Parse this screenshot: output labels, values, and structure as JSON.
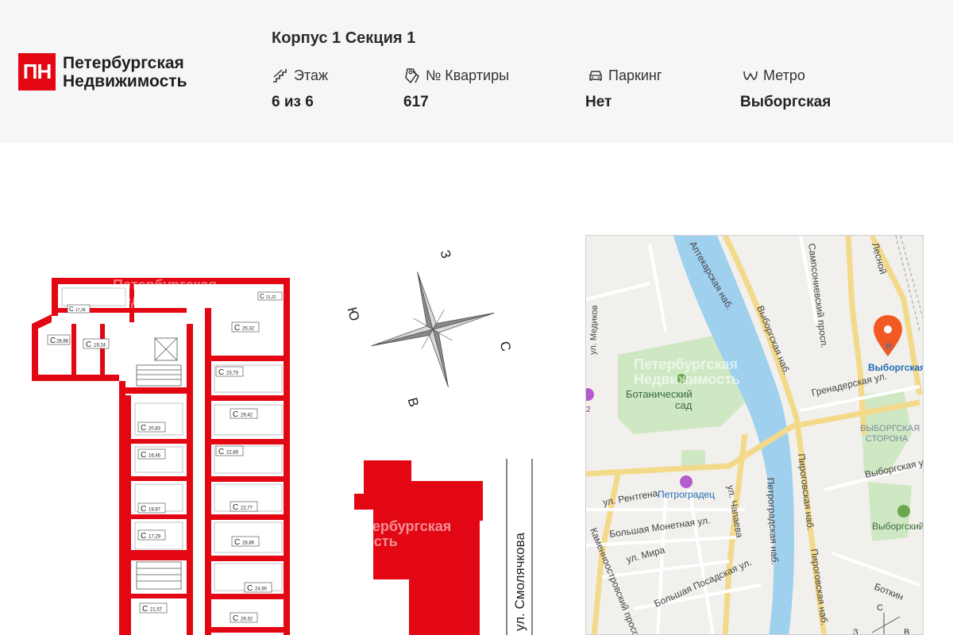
{
  "logo": {
    "mark": "ПН",
    "line1": "Петербургская",
    "line2": "Недвижимость"
  },
  "title": "Корпус 1 Секция 1",
  "stats": [
    {
      "label": "Этаж",
      "value": "6 из 6",
      "icon": "stairs-icon"
    },
    {
      "label": "№ Квартиры",
      "value": "617",
      "icon": "keys-icon"
    },
    {
      "label": "Паркинг",
      "value": "Нет",
      "icon": "car-icon"
    },
    {
      "label": "Метро",
      "value": "Выборгская",
      "icon": "metro-icon"
    }
  ],
  "compass": {
    "n": "С",
    "s": "Ю",
    "e": "В",
    "w": "З"
  },
  "street": "ул. Смолячкова",
  "watermark": {
    "line1": "Петербургская",
    "line2": "Недвижимость",
    "short1": "тербургская",
    "short2": "ость"
  },
  "plan": {
    "units": [
      {
        "label": "С",
        "area": "28,88"
      },
      {
        "label": "С",
        "area": "19,24"
      },
      {
        "label": "С",
        "area": "17,28"
      },
      {
        "label": "С",
        "area": "21,22"
      },
      {
        "label": "С",
        "area": "25,32"
      },
      {
        "label": "С",
        "area": "23,73"
      },
      {
        "label": "С",
        "area": "29,42"
      },
      {
        "label": "С",
        "area": "20,83"
      },
      {
        "label": "С",
        "area": "22,8б"
      },
      {
        "label": "С",
        "area": "16,46"
      },
      {
        "label": "С",
        "area": "19,87"
      },
      {
        "label": "С",
        "area": "22,77"
      },
      {
        "label": "С",
        "area": "17,29"
      },
      {
        "label": "С",
        "area": "28,86"
      },
      {
        "label": "С",
        "area": "24,90"
      },
      {
        "label": "С",
        "area": "21,57"
      },
      {
        "label": "С",
        "area": "29,32"
      }
    ]
  },
  "map": {
    "labels": {
      "apothecary_emb": "Аптекарская наб.",
      "vyborg_emb": "Выборгская наб.",
      "botanical1": "Ботанический",
      "botanical2": "сад",
      "grenader": "Гренадерская ул.",
      "vyb_side1": "ВЫБОРГСКАЯ",
      "vyb_side2": "СТОРОНА",
      "vyborgskaya_st": "Выборгская ул.",
      "samps": "Сампсониевский просп.",
      "pirog1": "Пироговская наб.",
      "pirog2": "Пироговская наб.",
      "petrograd_emb": "Петроградская наб.",
      "petrogradets": "Петроградец",
      "rentgena": "ул. Рентгена",
      "chapaeva": "ул. Чапаева",
      "monetnaya": "Большая Монетная ул.",
      "mira": "ул. Мира",
      "posadskaya": "Большая Посадская ул.",
      "kamennoostr": "Каменноостровский просп.",
      "botkin": "Боткин",
      "vyborgsky": "Выборгский",
      "medikov": "ул. Медиков",
      "metro": "Выборгская",
      "lesnoy": "Лесной",
      "poi_num": "2",
      "compass_n": "С",
      "compass_e": "В",
      "compass_w": "З"
    }
  }
}
